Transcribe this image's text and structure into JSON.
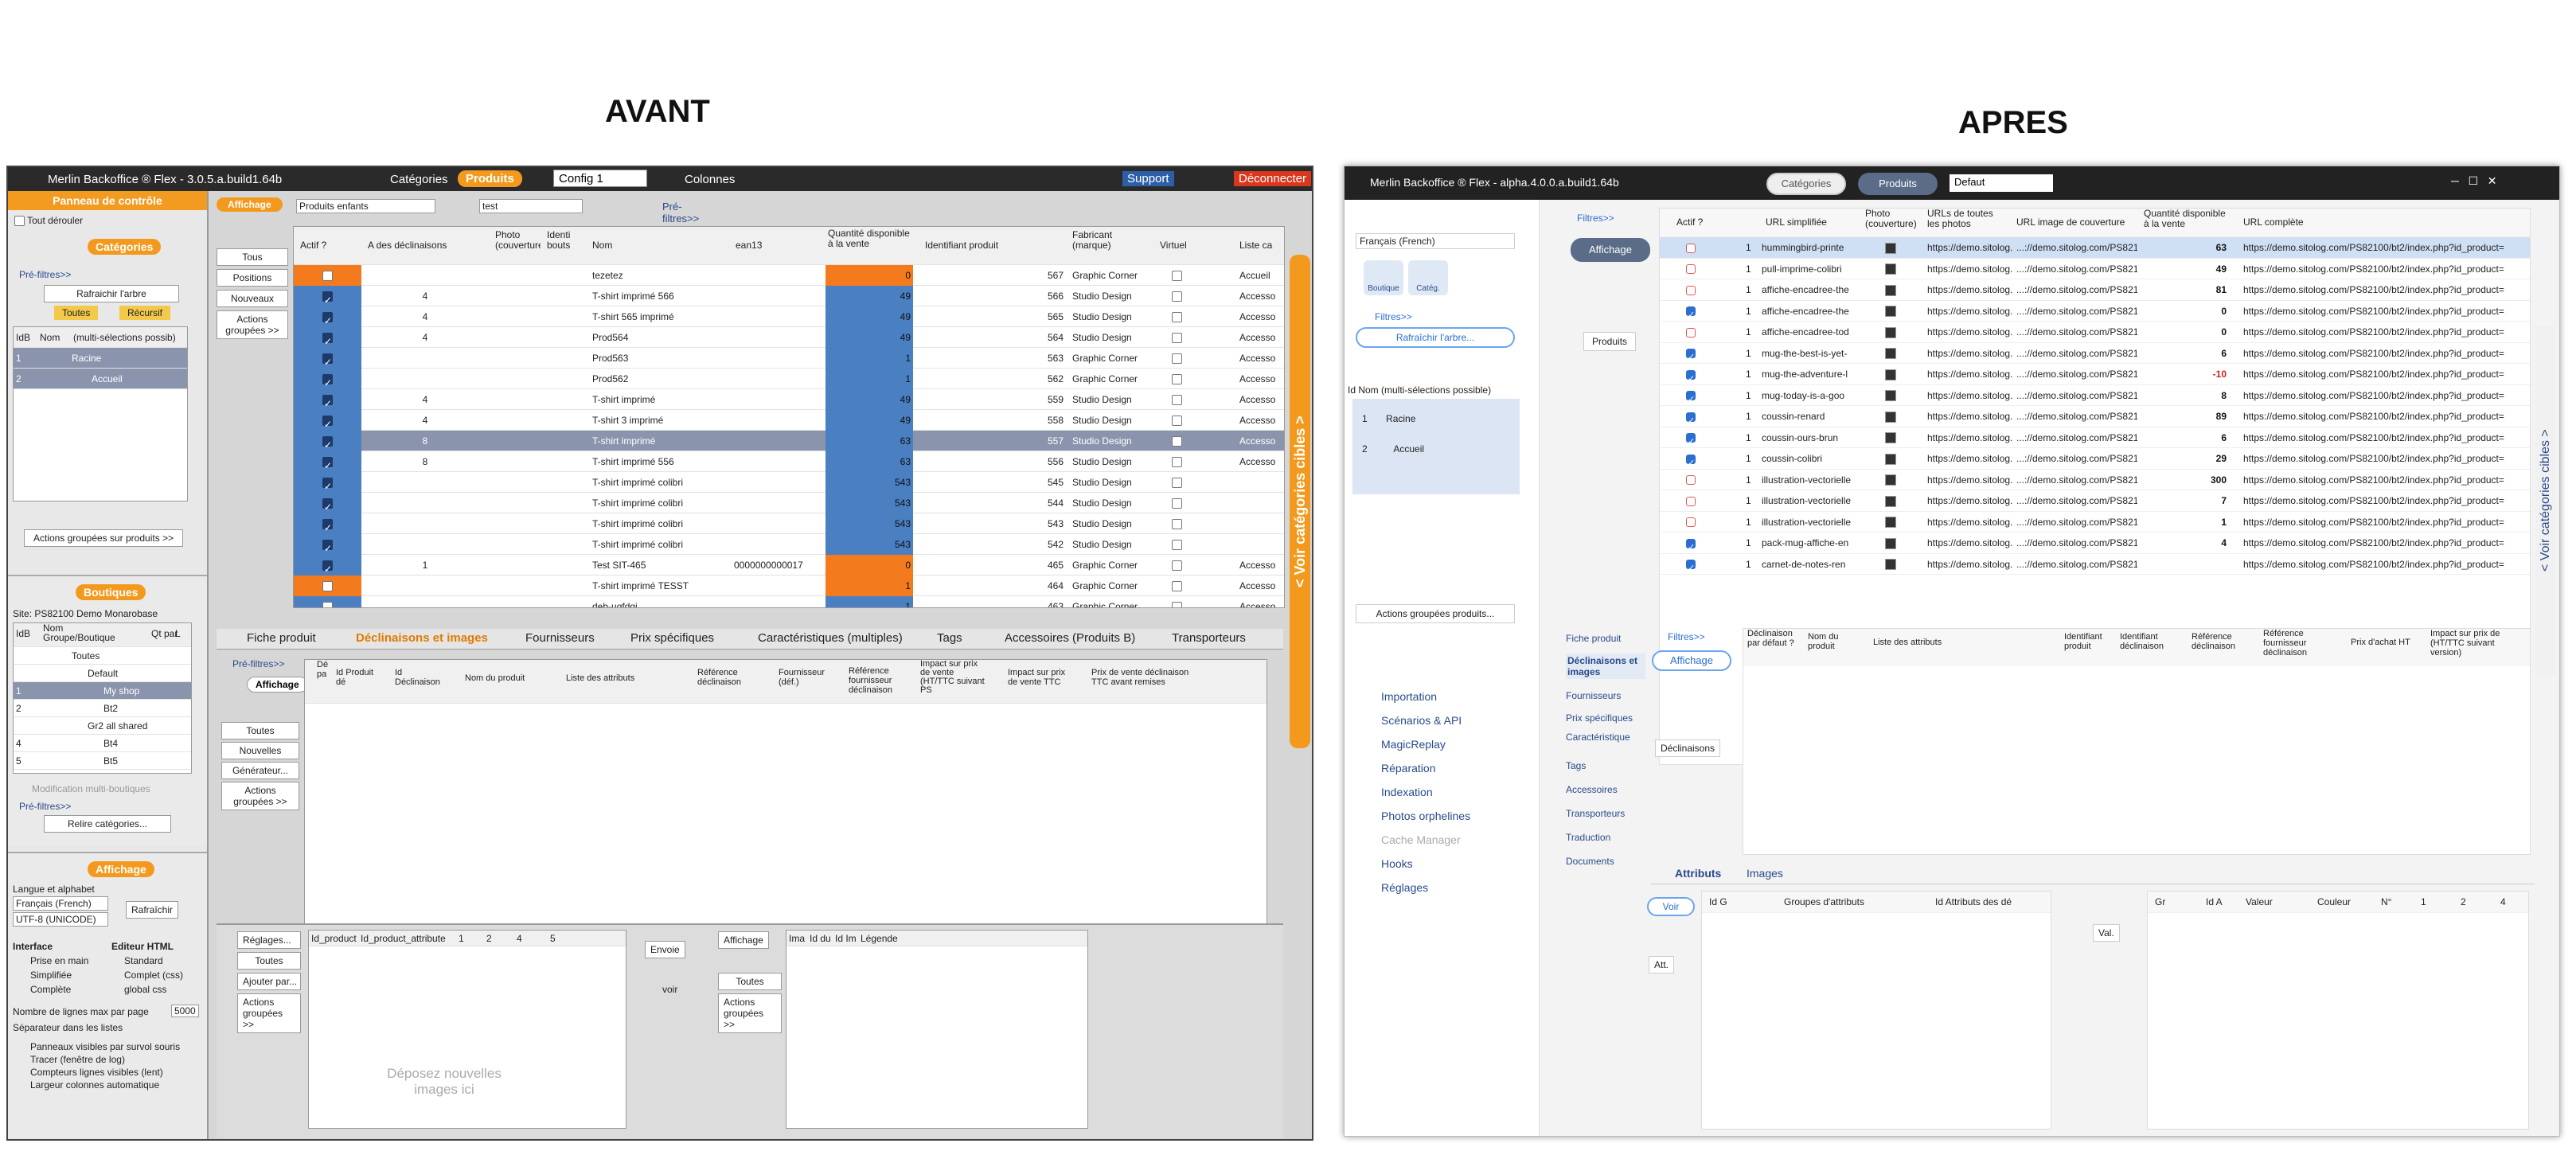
{
  "labels": {
    "before": "AVANT",
    "after": "APRES"
  },
  "before": {
    "title": "Merlin Backoffice ® Flex - 3.0.5.a.build1.64b",
    "tab_categories": "Catégories",
    "tab_products": "Produits",
    "config": "Config 1",
    "columns": "Colonnes",
    "support": "Support",
    "disconnect": "Déconnecter",
    "control_panel": "Panneau de contrôle",
    "expand_all": "Tout dérouler",
    "categories": "Catégories",
    "pre_filters": "Pré-filtres>>",
    "refresh_tree": "Rafraichir l'arbre",
    "all": "Toutes",
    "recursive": "Récursif",
    "cat_col_id": "IdB",
    "cat_col_name": "Nom",
    "cat_col_multi": "(multi-sélections possib)",
    "categories_tree": [
      {
        "n": "1",
        "name": "Racine"
      },
      {
        "n": "2",
        "name": "Accueil"
      }
    ],
    "grouped_products": "Actions groupées sur produits >>",
    "shops": "Boutiques",
    "site": "Site: PS82100 Demo Monarobase",
    "shop_cols": [
      "IdB",
      "Nom Groupe/Boutique",
      "Qt par",
      "L"
    ],
    "shops_list": [
      {
        "id": "",
        "name": "Toutes"
      },
      {
        "id": "",
        "name": "Default"
      },
      {
        "id": "1",
        "name": "My shop"
      },
      {
        "id": "2",
        "name": "Bt2"
      },
      {
        "id": "",
        "name": "Gr2 all shared"
      },
      {
        "id": "4",
        "name": "Bt4"
      },
      {
        "id": "5",
        "name": "Bt5"
      }
    ],
    "multi_shop_edit": "Modification multi-boutiques",
    "link_categories": "Relire catégories...",
    "display": "Affichage",
    "lang_alphabet": "Langue et alphabet",
    "lang": "Français (French)",
    "charset": "UTF-8 (UNICODE)",
    "refresh": "Rafraîchir",
    "interface": "Interface",
    "html_editor": "Editeur HTML",
    "iface_opts": [
      "Prise en main",
      "Simplifiée",
      "Complète"
    ],
    "html_opts": [
      "Standard",
      "Complet (css)",
      "global css"
    ],
    "lines_per_page": "Nombre de lignes max par page",
    "lines_value": "5000",
    "list_sep": "Séparateur dans les listes",
    "checks": [
      "Panneaux visibles par survol souris",
      "Tracer (fenêtre de log)",
      "Compteurs lignes visibles (lent)",
      "Largeur colonnes automatique"
    ],
    "view": "Affichage",
    "child_products": "Produits enfants",
    "search_value": "test",
    "side_buttons": [
      "Tous",
      "Positions",
      "Nouveaux",
      "Actions groupées >>"
    ],
    "prod_cols": [
      "Actif ?",
      "A des déclinaisons",
      "Photo (couverture)",
      "Identi bouts",
      "Nom",
      "ean13",
      "Quantité disponible à la vente",
      "Identifiant produit",
      "Fabricant (marque)",
      "Virtuel",
      "Liste ca"
    ],
    "products": [
      {
        "active": false,
        "decl": "",
        "name": "tezetez",
        "ean": "",
        "qty": "0",
        "id": "567",
        "maker": "Graphic Corner",
        "list": "Accueil",
        "hl": "o"
      },
      {
        "active": true,
        "decl": "4",
        "name": "T-shirt imprimé 566",
        "ean": "",
        "qty": "49",
        "id": "566",
        "maker": "Studio Design",
        "list": "Accesso",
        "hl": ""
      },
      {
        "active": true,
        "decl": "4",
        "name": "T-shirt 565 imprimé",
        "ean": "",
        "qty": "49",
        "id": "565",
        "maker": "Studio Design",
        "list": "Accesso",
        "hl": ""
      },
      {
        "active": true,
        "decl": "4",
        "name": "Prod564",
        "ean": "",
        "qty": "49",
        "id": "564",
        "maker": "Studio Design",
        "list": "Accesso",
        "hl": ""
      },
      {
        "active": true,
        "decl": "",
        "name": "Prod563",
        "ean": "",
        "qty": "1",
        "id": "563",
        "maker": "Graphic Corner",
        "list": "Accesso",
        "hl": ""
      },
      {
        "active": true,
        "decl": "",
        "name": "Prod562",
        "ean": "",
        "qty": "1",
        "id": "562",
        "maker": "Graphic Corner",
        "list": "Accesso",
        "hl": ""
      },
      {
        "active": true,
        "decl": "4",
        "name": "T-shirt imprimé",
        "ean": "",
        "qty": "49",
        "id": "559",
        "maker": "Studio Design",
        "list": "Accesso",
        "hl": ""
      },
      {
        "active": true,
        "decl": "4",
        "name": "T-shirt 3 imprimé",
        "ean": "",
        "qty": "49",
        "id": "558",
        "maker": "Studio Design",
        "list": "Accesso",
        "hl": ""
      },
      {
        "active": true,
        "decl": "8",
        "name": "T-shirt imprimé",
        "ean": "",
        "qty": "63",
        "id": "557",
        "maker": "Studio Design",
        "list": "Accesso",
        "hl": "s"
      },
      {
        "active": true,
        "decl": "8",
        "name": "T-shirt imprimé 556",
        "ean": "",
        "qty": "63",
        "id": "556",
        "maker": "Studio Design",
        "list": "Accesso",
        "hl": ""
      },
      {
        "active": true,
        "decl": "",
        "name": "T-shirt imprimé colibri",
        "ean": "",
        "qty": "543",
        "id": "545",
        "maker": "Studio Design",
        "list": "",
        "hl": ""
      },
      {
        "active": true,
        "decl": "",
        "name": "T-shirt imprimé colibri",
        "ean": "",
        "qty": "543",
        "id": "544",
        "maker": "Studio Design",
        "list": "",
        "hl": ""
      },
      {
        "active": true,
        "decl": "",
        "name": "T-shirt imprimé colibri",
        "ean": "",
        "qty": "543",
        "id": "543",
        "maker": "Studio Design",
        "list": "",
        "hl": ""
      },
      {
        "active": true,
        "decl": "",
        "name": "T-shirt imprimé colibri",
        "ean": "",
        "qty": "543",
        "id": "542",
        "maker": "Studio Design",
        "list": "",
        "hl": ""
      },
      {
        "active": true,
        "decl": "1",
        "name": "Test SIT-465",
        "ean": "0000000000017",
        "qty": "0",
        "id": "465",
        "maker": "Graphic Corner",
        "list": "Accesso",
        "hl": ""
      },
      {
        "active": false,
        "decl": "",
        "name": "T-shirt imprimé TESST",
        "ean": "",
        "qty": "1",
        "id": "464",
        "maker": "Graphic Corner",
        "list": "Accesso",
        "hl": "o"
      },
      {
        "active": false,
        "decl": "",
        "name": "deb-ugfdgj",
        "ean": "",
        "qty": "1",
        "id": "463",
        "maker": "Graphic Corner",
        "list": "Accesso",
        "hl": ""
      }
    ],
    "vbar": "< Voir catégories cibles >",
    "detail_tabs": [
      "Fiche produit",
      "Déclinaisons et images",
      "Fournisseurs",
      "Prix spécifiques",
      "Caractéristiques (multiples)",
      "Tags",
      "Accessoires (Produits B)",
      "Transporteurs"
    ],
    "decl_cols": [
      "Dé pa",
      "Id Produit dé",
      "Id Déclinaison",
      "Nom du produit",
      "Liste des attributs",
      "Référence déclinaison",
      "Fournisseur (déf.)",
      "Référence fournisseur déclinaison",
      "Impact sur prix de vente (HT/TTC suivant PS",
      "Impact sur prix de vente TTC",
      "Prix de vente déclinaison TTC avant remises"
    ],
    "decl_buttons": [
      "Toutes",
      "Nouvelles",
      "Générateur...",
      "Actions groupées >>"
    ],
    "img_cols": [
      "Id_product",
      "Id_product_attribute",
      "1",
      "2",
      "4",
      "5"
    ],
    "drop_images": "Déposez nouvelles images ici",
    "img_buttons": [
      "Réglages...",
      "Toutes",
      "Ajouter par...",
      "Actions groupées >>"
    ],
    "send": "Envoie",
    "see": "voir",
    "attr_tab": "Attributs",
    "images_tab": "Images",
    "legend_cols": [
      "Ima",
      "Id du",
      "Id Im",
      "Légende"
    ]
  },
  "after": {
    "title": "Merlin Backoffice ® Flex - alpha.4.0.0.a.build1.64b",
    "tab_categories": "Catégories",
    "tab_products": "Produits",
    "config": "Defaut",
    "lang": "Français (French)",
    "shop": "Boutique",
    "cats": "Catég.",
    "filters": "Filtres>>",
    "refresh_tree": "Rafraîchir l'arbre...",
    "cat_col": "Id Nom (multi-sélections possible)",
    "categories_tree": [
      {
        "n": "1",
        "name": "Racine"
      },
      {
        "n": "2",
        "name": "Accueil"
      }
    ],
    "grouped_products": "Actions groupées produits...",
    "menu": [
      "Importation",
      "Scénarios & API",
      "MagicReplay",
      "Réparation",
      "Indexation",
      "Photos orphelines",
      "Cache Manager",
      "Hooks",
      "Réglages"
    ],
    "display": "Affichage",
    "products_label": "Produits",
    "prod_cols": [
      "Actif ?",
      "URL simplifiée",
      "Photo (couverture)",
      "URLs de toutes les photos",
      "URL image de couverture",
      "Quantité disponible à la vente",
      "URL complète"
    ],
    "products": [
      {
        "active": false,
        "n": "1",
        "slug": "hummingbird-printe",
        "qty": "63",
        "sel": true
      },
      {
        "active": false,
        "n": "1",
        "slug": "pull-imprime-colibri",
        "qty": "49",
        "sel": false
      },
      {
        "active": false,
        "n": "1",
        "slug": "affiche-encadree-the",
        "qty": "81",
        "sel": false
      },
      {
        "active": true,
        "n": "1",
        "slug": "affiche-encadree-the",
        "qty": "0",
        "sel": false
      },
      {
        "active": false,
        "n": "1",
        "slug": "affiche-encadree-tod",
        "qty": "0",
        "sel": false
      },
      {
        "active": true,
        "n": "1",
        "slug": "mug-the-best-is-yet-",
        "qty": "6",
        "sel": false
      },
      {
        "active": true,
        "n": "1",
        "slug": "mug-the-adventure-l",
        "qty": "-10",
        "sel": false
      },
      {
        "active": true,
        "n": "1",
        "slug": "mug-today-is-a-goo",
        "qty": "8",
        "sel": false
      },
      {
        "active": true,
        "n": "1",
        "slug": "coussin-renard",
        "qty": "89",
        "sel": false
      },
      {
        "active": true,
        "n": "1",
        "slug": "coussin-ours-brun",
        "qty": "6",
        "sel": false
      },
      {
        "active": true,
        "n": "1",
        "slug": "coussin-colibri",
        "qty": "29",
        "sel": false
      },
      {
        "active": false,
        "n": "1",
        "slug": "illustration-vectorielle",
        "qty": "300",
        "sel": false
      },
      {
        "active": false,
        "n": "1",
        "slug": "illustration-vectorielle",
        "qty": "7",
        "sel": false
      },
      {
        "active": false,
        "n": "1",
        "slug": "illustration-vectorielle",
        "qty": "1",
        "sel": false
      },
      {
        "active": true,
        "n": "1",
        "slug": "pack-mug-affiche-en",
        "qty": "4",
        "sel": false
      },
      {
        "active": true,
        "n": "1",
        "slug": "carnet-de-notes-ren",
        "qty": "",
        "sel": false
      }
    ],
    "url_photos": "https://demo.sitolog.c...",
    "url_cover": "...://demo.sitolog.com/PS821",
    "url_full": "https://demo.sitolog.com/PS82100/bt2/index.php?id_product=",
    "vbar": "< Voir catégories cibles >",
    "vtabs": [
      "Fiche produit",
      "Déclinaisons et images",
      "Fournisseurs",
      "Prix spécifiques",
      "Caractéristique",
      "Tags",
      "Accessoires",
      "Transporteurs",
      "Traduction",
      "Documents"
    ],
    "decl_label": "Déclinaisons",
    "decl_cols": [
      "Déclinaison par défaut ?",
      "Nom du produit",
      "Liste des attributs",
      "Identifiant produit",
      "Identifiant déclinaison",
      "Référence déclinaison",
      "Référence fournisseur déclinaison",
      "Prix d'achat HT",
      "Impact sur prix de (HT/TTC suivant version)"
    ],
    "attr_tab": "Attributs",
    "images_tab": "Images",
    "see": "Voir",
    "att": "Att.",
    "val": "Val.",
    "attr_cols": [
      "Id G",
      "Groupes d'attributs",
      "Id Attributs des dé"
    ],
    "val_cols": [
      "Gr",
      "Id A",
      "Valeur",
      "Couleur",
      "N°",
      "1",
      "2",
      "4"
    ]
  },
  "colors": {
    "orange": "#f39a1e",
    "blue": "#4a7fc1",
    "navy": "#1d3a6b",
    "accent2": "#2a6fd0"
  }
}
